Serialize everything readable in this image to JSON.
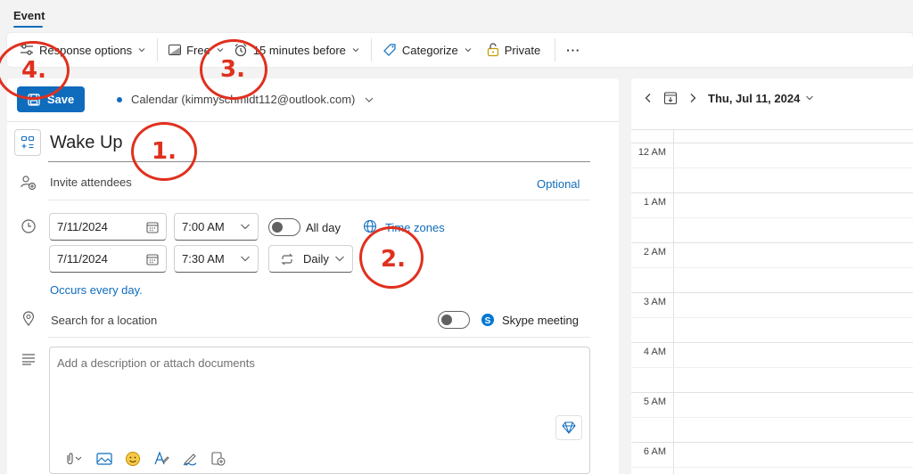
{
  "tab": {
    "label": "Event"
  },
  "toolbar": {
    "response_options": "Response options",
    "show_as": "Free",
    "reminder": "15 minutes before",
    "categorize": "Categorize",
    "private": "Private",
    "more": "···"
  },
  "header": {
    "save_label": "Save",
    "calendar_label": "Calendar (kimmyschmidt112@outlook.com)"
  },
  "event": {
    "title": "Wake Up",
    "invite_placeholder": "Invite attendees",
    "optional_label": "Optional",
    "start_date": "7/11/2024",
    "start_time": "7:00 AM",
    "all_day_label": "All day",
    "all_day_on": false,
    "time_zones_label": "Time zones",
    "end_date": "7/11/2024",
    "end_time": "7:30 AM",
    "repeat": "Daily",
    "occurs_text": "Occurs every day.",
    "location_placeholder": "Search for a location",
    "skype_label": "Skype meeting",
    "skype_on": false,
    "description_placeholder": "Add a description or attach documents"
  },
  "calendar": {
    "date_label": "Thu, Jul 11, 2024",
    "hours": [
      "12 AM",
      "1 AM",
      "2 AM",
      "3 AM",
      "4 AM",
      "5 AM",
      "6 AM"
    ]
  },
  "annotations": [
    "1.",
    "2.",
    "3.",
    "4."
  ],
  "colors": {
    "accent": "#0f6cbd",
    "annotation": "#e0301e"
  }
}
